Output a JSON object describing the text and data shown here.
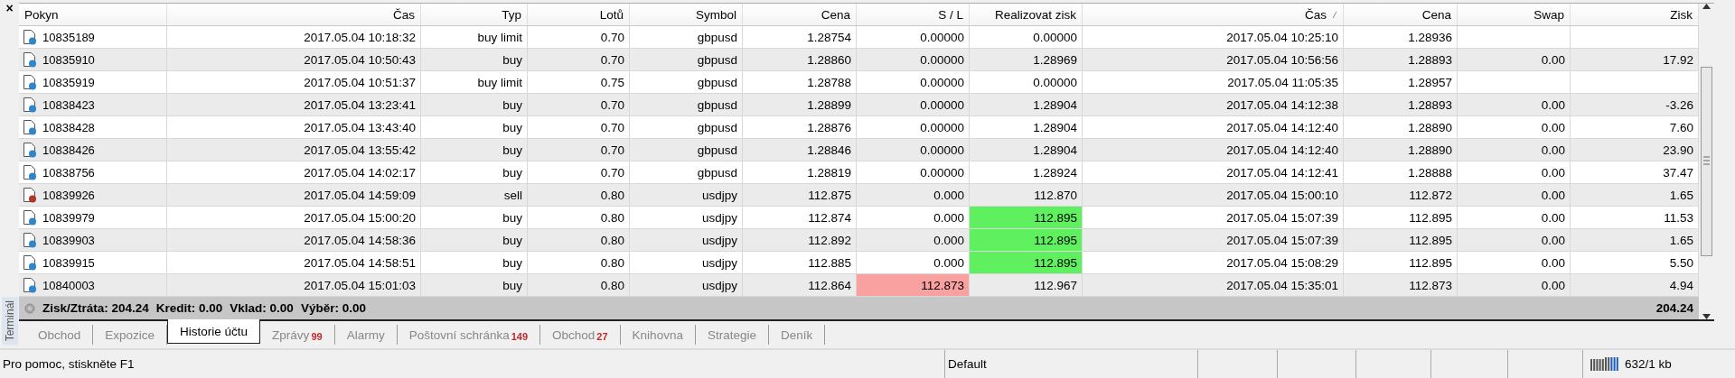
{
  "close_label": "×",
  "panel_title": "Terminál",
  "columns": [
    {
      "label": "Pokyn",
      "sorted": false
    },
    {
      "label": "Čas",
      "sorted": false
    },
    {
      "label": "Typ",
      "sorted": false
    },
    {
      "label": "Lotů",
      "sorted": false
    },
    {
      "label": "Symbol",
      "sorted": false
    },
    {
      "label": "Cena",
      "sorted": false
    },
    {
      "label": "S / L",
      "sorted": false
    },
    {
      "label": "Realizovat zisk",
      "sorted": false
    },
    {
      "label": "Čas",
      "sorted": true
    },
    {
      "label": "Cena",
      "sorted": false
    },
    {
      "label": "Swap",
      "sorted": false
    },
    {
      "label": "Zisk",
      "sorted": false
    }
  ],
  "rows": [
    {
      "kind": "buy",
      "order": "10835189",
      "open_time": "2017.05.04 10:18:32",
      "type": "buy limit",
      "lots": "0.70",
      "symbol": "gbpusd",
      "open_price": "1.28754",
      "sl": "0.00000",
      "tp": "0.00000",
      "sl_hit": false,
      "tp_hit": false,
      "close_time": "2017.05.04 10:25:10",
      "close_price": "1.28936"
    },
    {
      "kind": "buy",
      "order": "10835910",
      "open_time": "2017.05.04 10:50:43",
      "type": "buy",
      "lots": "0.70",
      "symbol": "gbpusd",
      "open_price": "1.28860",
      "sl": "0.00000",
      "tp": "1.28969",
      "sl_hit": false,
      "tp_hit": false,
      "close_time": "2017.05.04 10:56:56",
      "close_price": "1.28893",
      "swap": "0.00",
      "profit": "17.92"
    },
    {
      "kind": "buy",
      "order": "10835919",
      "open_time": "2017.05.04 10:51:37",
      "type": "buy limit",
      "lots": "0.75",
      "symbol": "gbpusd",
      "open_price": "1.28788",
      "sl": "0.00000",
      "tp": "0.00000",
      "sl_hit": false,
      "tp_hit": false,
      "close_time": "2017.05.04 11:05:35",
      "close_price": "1.28957"
    },
    {
      "kind": "buy",
      "order": "10838423",
      "open_time": "2017.05.04 13:23:41",
      "type": "buy",
      "lots": "0.70",
      "symbol": "gbpusd",
      "open_price": "1.28899",
      "sl": "0.00000",
      "tp": "1.28904",
      "sl_hit": false,
      "tp_hit": false,
      "close_time": "2017.05.04 14:12:38",
      "close_price": "1.28893",
      "swap": "0.00",
      "profit": "-3.26"
    },
    {
      "kind": "buy",
      "order": "10838428",
      "open_time": "2017.05.04 13:43:40",
      "type": "buy",
      "lots": "0.70",
      "symbol": "gbpusd",
      "open_price": "1.28876",
      "sl": "0.00000",
      "tp": "1.28904",
      "sl_hit": false,
      "tp_hit": false,
      "close_time": "2017.05.04 14:12:40",
      "close_price": "1.28890",
      "swap": "0.00",
      "profit": "7.60"
    },
    {
      "kind": "buy",
      "order": "10838426",
      "open_time": "2017.05.04 13:55:42",
      "type": "buy",
      "lots": "0.70",
      "symbol": "gbpusd",
      "open_price": "1.28846",
      "sl": "0.00000",
      "tp": "1.28904",
      "sl_hit": false,
      "tp_hit": false,
      "close_time": "2017.05.04 14:12:40",
      "close_price": "1.28890",
      "swap": "0.00",
      "profit": "23.90"
    },
    {
      "kind": "buy",
      "order": "10838756",
      "open_time": "2017.05.04 14:02:17",
      "type": "buy",
      "lots": "0.70",
      "symbol": "gbpusd",
      "open_price": "1.28819",
      "sl": "0.00000",
      "tp": "1.28924",
      "sl_hit": false,
      "tp_hit": false,
      "close_time": "2017.05.04 14:12:41",
      "close_price": "1.28888",
      "swap": "0.00",
      "profit": "37.47"
    },
    {
      "kind": "sell",
      "order": "10839926",
      "open_time": "2017.05.04 14:59:09",
      "type": "sell",
      "lots": "0.80",
      "symbol": "usdjpy",
      "open_price": "112.875",
      "sl": "0.000",
      "tp": "112.870",
      "sl_hit": false,
      "tp_hit": false,
      "close_time": "2017.05.04 15:00:10",
      "close_price": "112.872",
      "swap": "0.00",
      "profit": "1.65"
    },
    {
      "kind": "buy",
      "order": "10839979",
      "open_time": "2017.05.04 15:00:20",
      "type": "buy",
      "lots": "0.80",
      "symbol": "usdjpy",
      "open_price": "112.874",
      "sl": "0.000",
      "tp": "112.895",
      "sl_hit": false,
      "tp_hit": true,
      "close_time": "2017.05.04 15:07:39",
      "close_price": "112.895",
      "swap": "0.00",
      "profit": "11.53"
    },
    {
      "kind": "buy",
      "order": "10839903",
      "open_time": "2017.05.04 14:58:36",
      "type": "buy",
      "lots": "0.80",
      "symbol": "usdjpy",
      "open_price": "112.892",
      "sl": "0.000",
      "tp": "112.895",
      "sl_hit": false,
      "tp_hit": true,
      "close_time": "2017.05.04 15:07:39",
      "close_price": "112.895",
      "swap": "0.00",
      "profit": "1.65"
    },
    {
      "kind": "buy",
      "order": "10839915",
      "open_time": "2017.05.04 14:58:51",
      "type": "buy",
      "lots": "0.80",
      "symbol": "usdjpy",
      "open_price": "112.885",
      "sl": "0.000",
      "tp": "112.895",
      "sl_hit": false,
      "tp_hit": true,
      "close_time": "2017.05.04 15:08:29",
      "close_price": "112.895",
      "swap": "0.00",
      "profit": "5.50"
    },
    {
      "kind": "buy",
      "order": "10840003",
      "open_time": "2017.05.04 15:01:03",
      "type": "buy",
      "lots": "0.80",
      "symbol": "usdjpy",
      "open_price": "112.864",
      "sl": "112.873",
      "tp": "112.967",
      "sl_hit": true,
      "tp_hit": false,
      "close_time": "2017.05.04 15:35:01",
      "close_price": "112.873",
      "swap": "0.00",
      "profit": "4.94"
    }
  ],
  "summary": {
    "items": [
      "Zisk/Ztráta: 204.24",
      "Kredit: 0.00",
      "Vklad: 0.00",
      "Výběr: 0.00"
    ],
    "total": "204.24"
  },
  "tabs": [
    {
      "label": "Obchod",
      "selected": false
    },
    {
      "label": "Expozice",
      "selected": false
    },
    {
      "label": "Historie účtu",
      "selected": true
    },
    {
      "label": "Zprávy",
      "badge": "99",
      "selected": false
    },
    {
      "label": "Alarmy",
      "selected": false
    },
    {
      "label": "Poštovní schránka",
      "badge": "149",
      "selected": false
    },
    {
      "label": "Obchod",
      "badge": "27",
      "selected": false
    },
    {
      "label": "Knihovna",
      "selected": false
    },
    {
      "label": "Strategie",
      "selected": false
    },
    {
      "label": "Deník",
      "selected": false
    }
  ],
  "status_bar": {
    "help": "Pro pomoc, stiskněte F1",
    "profile": "Default",
    "traffic": "632/1 kb"
  }
}
